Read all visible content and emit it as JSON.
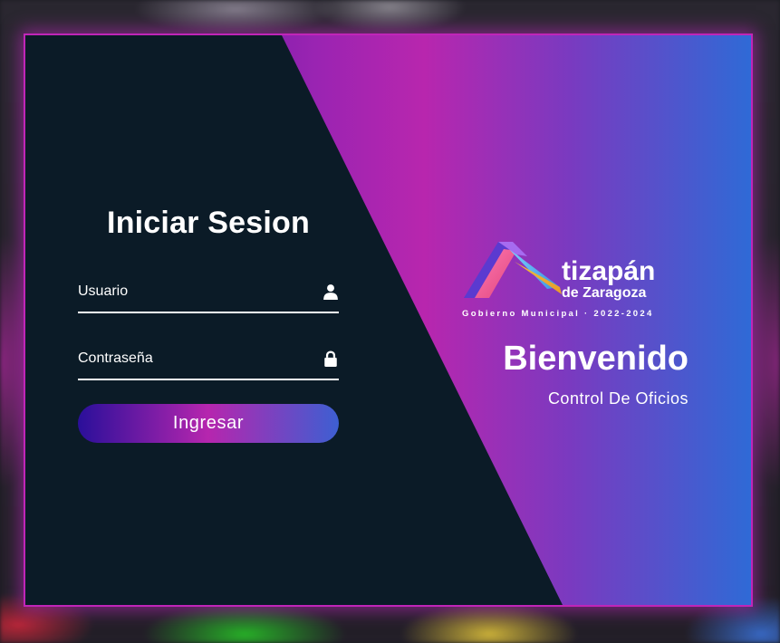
{
  "login": {
    "title": "Iniciar Sesion",
    "username_placeholder": "Usuario",
    "username_value": "",
    "password_placeholder": "Contraseña",
    "password_value": "",
    "submit_label": "Ingresar"
  },
  "branding": {
    "logo_name": "tizapán",
    "logo_subname": "de Zaragoza",
    "logo_tagline": "Gobierno Municipal · 2022-2024",
    "welcome": "Bienvenido",
    "subtitle": "Control De Oficios"
  },
  "icons": {
    "username": "user-icon",
    "password": "lock-icon"
  },
  "colors": {
    "panel_dark": "#0b1b27",
    "accent_magenta": "#b826ae",
    "accent_indigo": "#3a0d96",
    "accent_blue": "#2f6ad6",
    "border": "#c025b8"
  }
}
